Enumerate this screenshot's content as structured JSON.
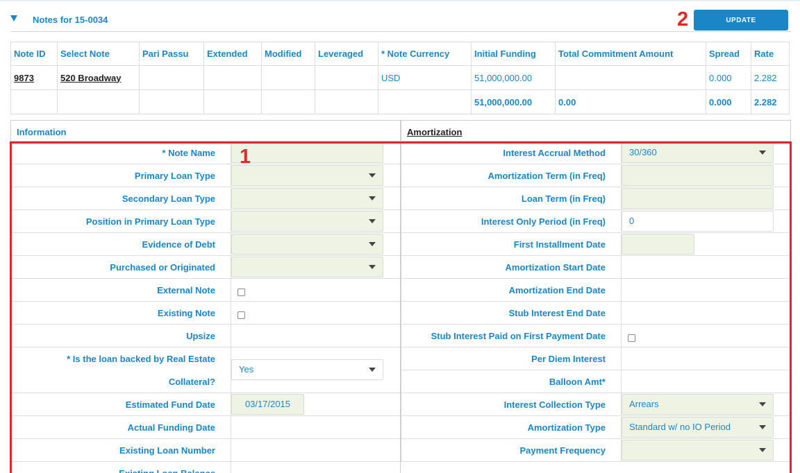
{
  "header": {
    "title": "Notes for 15-0034",
    "update_label": "UPDATE",
    "mark_update": "2",
    "mark_form": "1"
  },
  "notes_table": {
    "columns": [
      "Note ID",
      "Select Note",
      "Pari Passu",
      "Extended",
      "Modified",
      "Leveraged",
      "* Note Currency",
      "Initial Funding",
      "Total Commitment Amount",
      "Spread",
      "Rate"
    ],
    "row": {
      "note_id": "9873",
      "select_note": "520 Broadway",
      "pari_passu": "",
      "extended": "",
      "modified": "",
      "leveraged": "",
      "currency": "USD",
      "initial_funding": "51,000,000.00",
      "total_commitment": "",
      "spread": "0.000",
      "rate": "2.282"
    },
    "totals": {
      "initial_funding": "51,000,000.00",
      "total_commitment": "0.00",
      "spread": "0.000",
      "rate": "2.282"
    }
  },
  "information": {
    "title": "Information",
    "rows": [
      {
        "label": "* Note Name",
        "type": "text",
        "value": ""
      },
      {
        "label": "Primary Loan Type",
        "type": "select",
        "value": ""
      },
      {
        "label": "Secondary Loan Type",
        "type": "select",
        "value": ""
      },
      {
        "label": "Position in Primary Loan Type",
        "type": "select",
        "value": ""
      },
      {
        "label": "Evidence of Debt",
        "type": "select",
        "value": ""
      },
      {
        "label": "Purchased or Originated",
        "type": "select",
        "value": ""
      },
      {
        "label": "External Note",
        "type": "checkbox",
        "value": ""
      },
      {
        "label": "Existing Note",
        "type": "checkbox",
        "value": ""
      },
      {
        "label": "Upsize",
        "type": "none",
        "value": ""
      },
      {
        "label": "* Is the loan backed by Real Estate",
        "label2": "Collateral?",
        "type": "select-white",
        "value": "Yes"
      },
      {
        "label": "Estimated Fund Date",
        "type": "date",
        "value": "03/17/2015"
      },
      {
        "label": "Actual Funding Date",
        "type": "none",
        "value": ""
      },
      {
        "label": "Existing Loan Number",
        "type": "none",
        "value": ""
      },
      {
        "label": "Existing Loan Balance",
        "type": "none",
        "value": ""
      }
    ]
  },
  "amortization": {
    "title": "Amortization",
    "rows": [
      {
        "label": "Interest Accrual Method",
        "type": "select",
        "value": "30/360"
      },
      {
        "label": "Amortization Term (in Freq)",
        "type": "text",
        "value": ""
      },
      {
        "label": "Loan Term (in Freq)",
        "type": "text",
        "value": ""
      },
      {
        "label": "Interest Only Period (in Freq)",
        "type": "text-white",
        "value": "0"
      },
      {
        "label": "First Installment Date",
        "type": "date",
        "value": ""
      },
      {
        "label": "Amortization Start Date",
        "type": "none",
        "value": ""
      },
      {
        "label": "Amortization End Date",
        "type": "none",
        "value": ""
      },
      {
        "label": "Stub Interest End Date",
        "type": "none",
        "value": ""
      },
      {
        "label": "Stub Interest Paid on First Payment Date",
        "type": "checkbox",
        "value": ""
      },
      {
        "label": "Per Diem Interest",
        "type": "none",
        "value": ""
      },
      {
        "label": "Balloon Amt*",
        "type": "none",
        "value": ""
      },
      {
        "label": "Interest Collection Type",
        "type": "select",
        "value": "Arrears"
      },
      {
        "label": "Amortization Type",
        "type": "select",
        "value": "Standard w/ no IO Period"
      },
      {
        "label": "Payment Frequency",
        "type": "select",
        "value": ""
      }
    ]
  }
}
